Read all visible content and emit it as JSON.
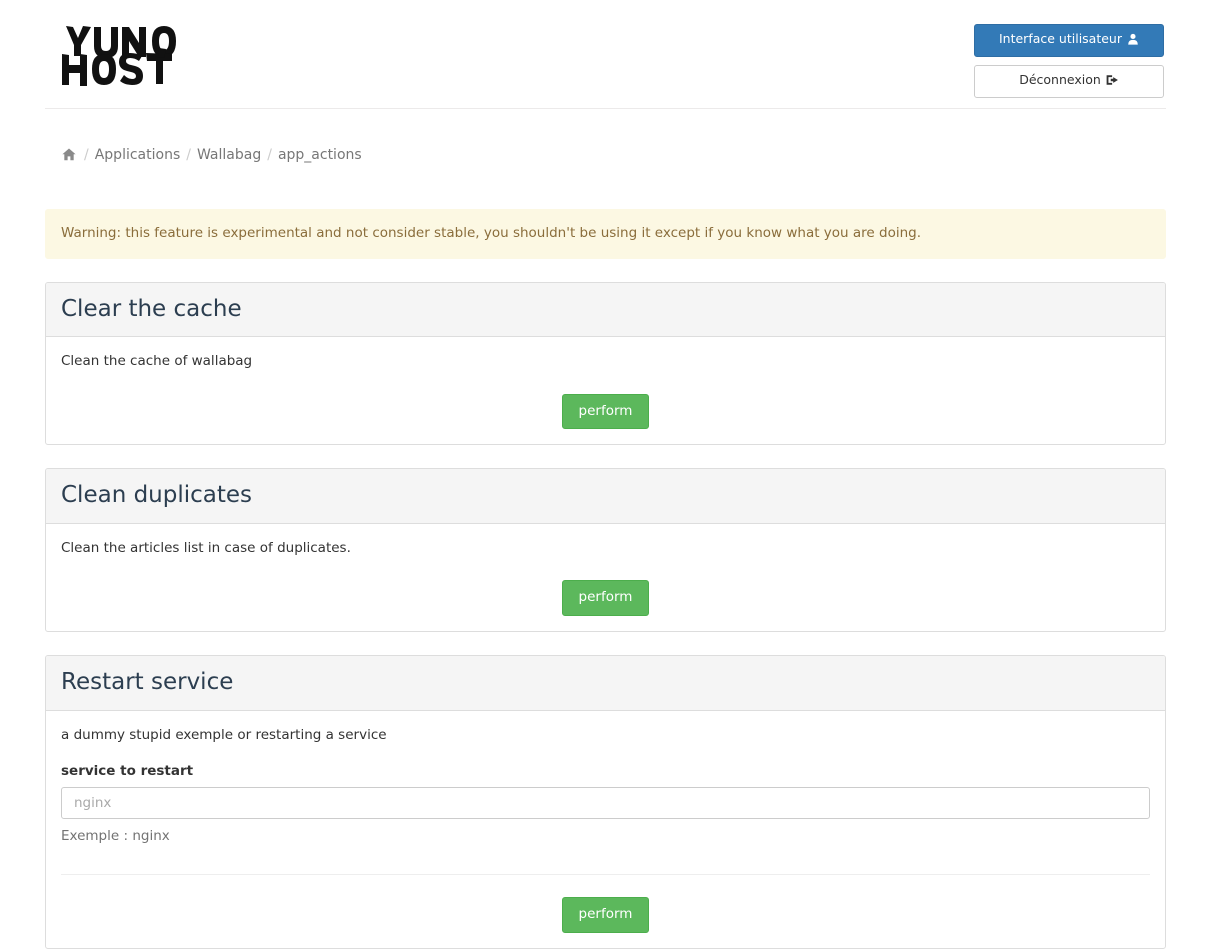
{
  "header": {
    "logo_alt": "YunoHost",
    "logo_line1": "YUNO",
    "logo_line2": "HOST",
    "user_interface_label": "Interface utilisateur",
    "user_interface_icon": "user-icon",
    "logout_label": "Déconnexion",
    "logout_icon": "sign-out-icon"
  },
  "breadcrumb": {
    "home_icon": "home-icon",
    "separator": "/",
    "items": [
      {
        "label": "Applications"
      },
      {
        "label": "Wallabag"
      },
      {
        "label": "app_actions"
      }
    ]
  },
  "alert": {
    "type": "warning",
    "text": "Warning: this feature is experimental and not consider stable, you shouldn't be using it except if you know what you are doing."
  },
  "actions": [
    {
      "title": "Clear the cache",
      "description": "Clean the cache of wallabag",
      "perform_label": "perform"
    },
    {
      "title": "Clean duplicates",
      "description": "Clean the articles list in case of duplicates.",
      "perform_label": "perform"
    },
    {
      "title": "Restart service",
      "description": "a dummy stupid exemple or restarting a service",
      "field_label": "service to restart",
      "field_value": "",
      "field_placeholder": "nginx",
      "field_help": "Exemple : nginx",
      "perform_label": "perform"
    }
  ],
  "colors": {
    "primary": "#337ab7",
    "success": "#5cb85c",
    "warning_bg": "#fcf8e3",
    "warning_text": "#8a6d3b",
    "panel_heading_bg": "#f5f5f5",
    "border": "#dddddd"
  }
}
